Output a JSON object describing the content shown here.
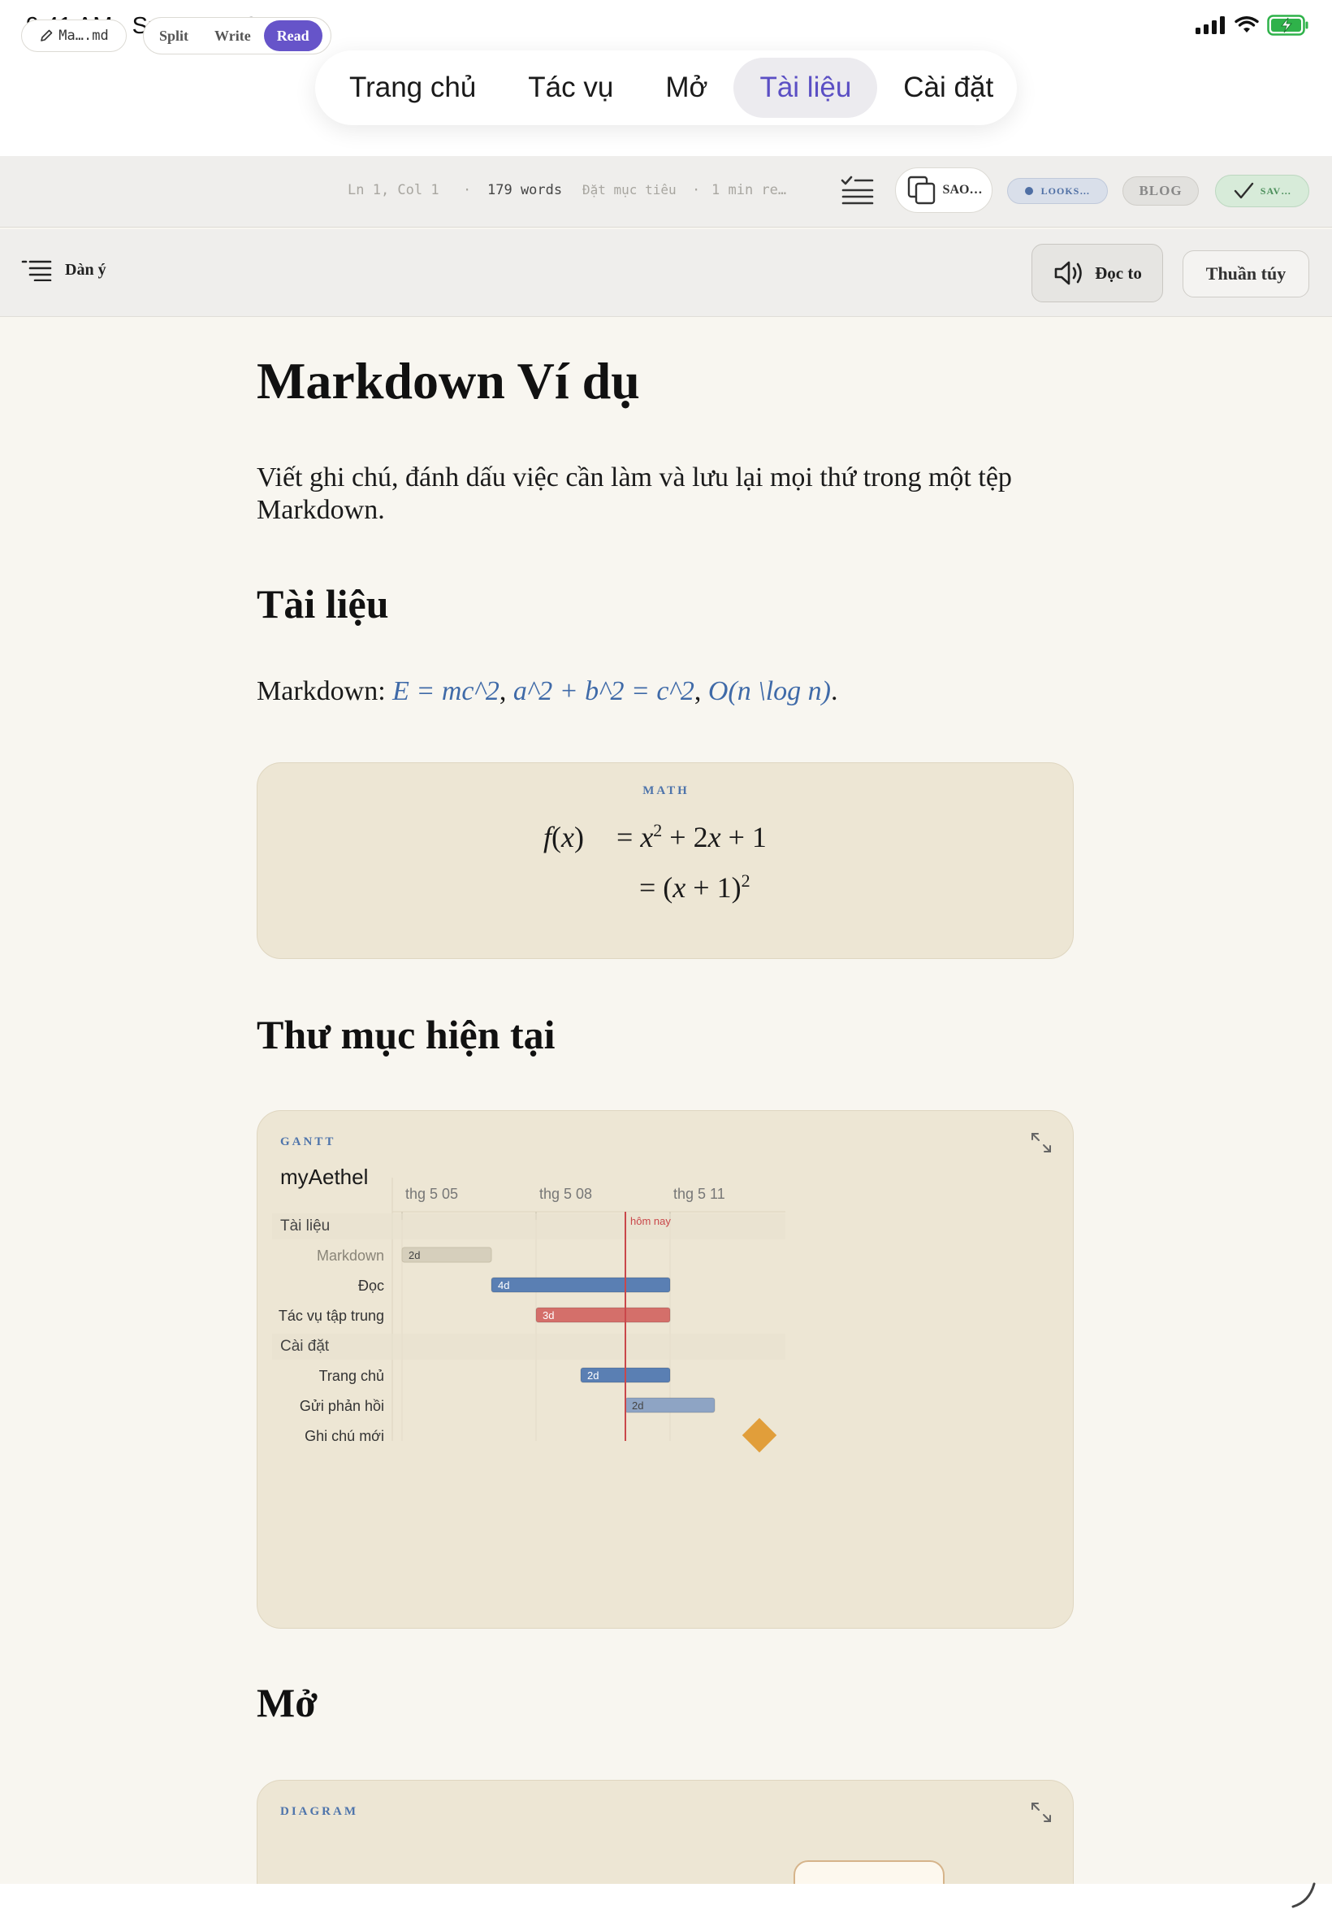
{
  "status": {
    "time": "9:41 AM",
    "date": "Sun May 10"
  },
  "nav": {
    "tabs": [
      {
        "label": "Trang chủ",
        "active": false
      },
      {
        "label": "Tác vụ",
        "active": false
      },
      {
        "label": "Mở",
        "active": false
      },
      {
        "label": "Tài liệu",
        "active": true
      },
      {
        "label": "Cài đặt",
        "active": false
      }
    ]
  },
  "toolbar": {
    "file": "Ma….md",
    "modes": [
      "Split",
      "Write",
      "Read"
    ],
    "active_mode": "Read",
    "position": "Ln 1, Col 1",
    "sep1": "·",
    "words": "179 words",
    "goal": "Đặt mục tiêu",
    "sep2": "·",
    "read_time": "1 min re…",
    "copy_label": "SAO…",
    "looks_label": "LOOKS…",
    "blog_label": "BLOG",
    "save_label": "SAV…"
  },
  "subbar": {
    "outline_label": "Dàn ý",
    "read_aloud_label": "Đọc to",
    "plain_label": "Thuần túy"
  },
  "doc": {
    "title": "Markdown Ví dụ",
    "intro": "Viết ghi chú, đánh dấu việc cần làm và lưu lại mọi thứ trong một tệp Markdown.",
    "h2_docs": "Tài liệu",
    "inline_prefix": "Markdown: ",
    "inline_m1": "E = mc^2",
    "inline_m2": "a^2 + b^2 = c^2",
    "inline_m3": "O(n \\log n)",
    "comma": ", ",
    "period": ".",
    "math_label": "MATH",
    "h2_folder": "Thư mục hiện tại",
    "h2_open": "Mở",
    "diagram_label": "DIAGRAM"
  },
  "gantt": {
    "label": "GANTT",
    "title": "myAethel",
    "today_label": "hôm nay",
    "axis_ticks": [
      "thg 5 05",
      "thg 5 08",
      "thg 5 11"
    ],
    "sections": [
      {
        "name": "Tài liệu",
        "tasks": [
          {
            "name": "Markdown",
            "start": 0,
            "duration": 2,
            "label": "2d",
            "status": "done"
          },
          {
            "name": "Đọc",
            "start": 2,
            "duration": 4,
            "label": "4d",
            "status": "active"
          },
          {
            "name": "Tác vụ tập trung",
            "start": 3,
            "duration": 3,
            "label": "3d",
            "status": "critical"
          }
        ]
      },
      {
        "name": "Cài đặt",
        "tasks": [
          {
            "name": "Trang chủ",
            "start": 4,
            "duration": 2,
            "label": "2d",
            "status": "active"
          },
          {
            "name": "Gửi phản hồi",
            "start": 5,
            "duration": 2,
            "label": "2d",
            "status": "future"
          },
          {
            "name": "Ghi chú mới",
            "start": 7,
            "duration": 0,
            "label": "",
            "status": "milestone"
          }
        ]
      }
    ],
    "today_offset_days": 5,
    "colors": {
      "done": "#d6cfbc",
      "active": "#5a7fb3",
      "critical": "#d46f6a",
      "future": "#8ea4c4",
      "milestone": "#e19e3a",
      "today": "#c9474a"
    }
  }
}
